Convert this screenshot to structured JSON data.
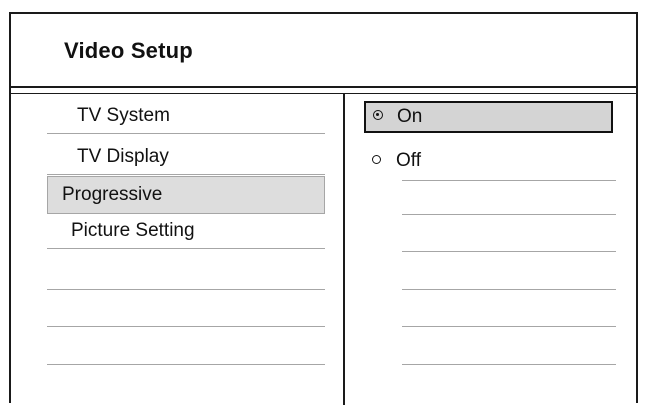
{
  "screen": {
    "title": "Video Setup"
  },
  "menu": {
    "items": [
      {
        "label": "TV System",
        "selected": false
      },
      {
        "label": "TV Display",
        "selected": false
      },
      {
        "label": "Progressive",
        "selected": true
      },
      {
        "label": "Picture Setting",
        "selected": false
      }
    ]
  },
  "options": {
    "items": [
      {
        "label": "On",
        "selected": true
      },
      {
        "label": "Off",
        "selected": false
      }
    ]
  }
}
